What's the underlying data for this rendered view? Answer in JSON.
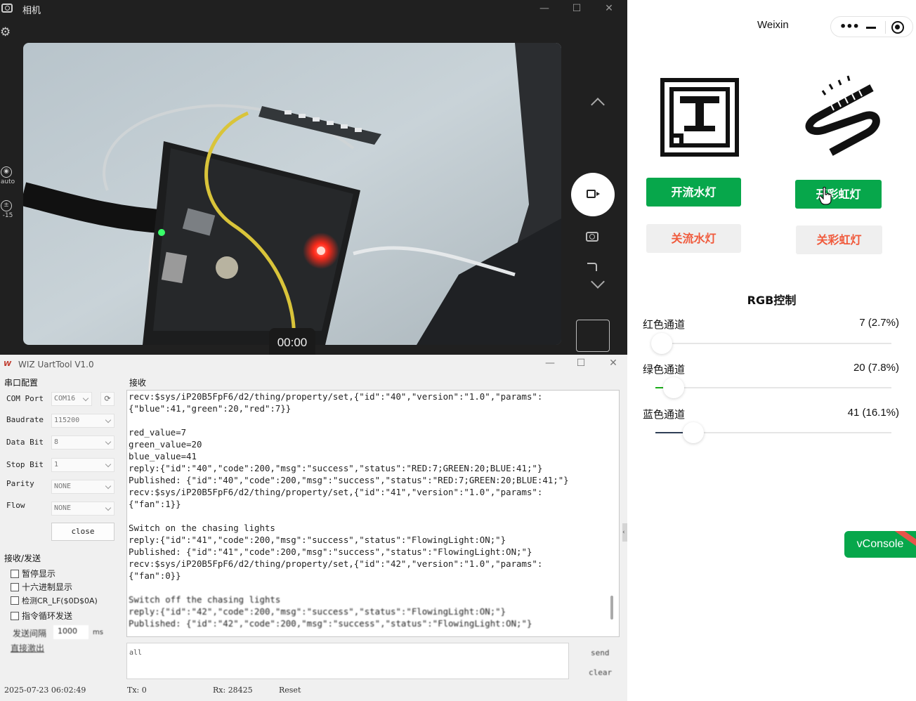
{
  "camera": {
    "title": "相机",
    "timer": "00:00",
    "auto_label": "auto",
    "ev_label": "-15",
    "window_controls": {
      "minimize": "—",
      "maximize": "☐",
      "close": "✕"
    }
  },
  "weixin": {
    "title": "Weixin",
    "buttons": {
      "flow_on": "开流水灯",
      "rainbow_on": "开彩虹灯",
      "flow_off": "关流水灯",
      "rainbow_off": "关彩虹灯"
    },
    "rgb_title": "RGB控制",
    "channels": [
      {
        "label": "红色通道",
        "value_text": "7 (2.7%)",
        "fraction": 0.027,
        "color": "#e64340"
      },
      {
        "label": "绿色通道",
        "value_text": "20 (7.8%)",
        "fraction": 0.078,
        "color": "#1aad19"
      },
      {
        "label": "蓝色通道",
        "value_text": "41 (16.1%)",
        "fraction": 0.161,
        "color": "#2f3f56"
      }
    ],
    "vconsole": "vConsole",
    "accent": "#07a74b",
    "off_text_color": "#f05a3c"
  },
  "uart": {
    "title": "WIZ UartTool V1.0",
    "serial_section": "串口配置",
    "fields": [
      {
        "label": "COM Port",
        "value": "COM16"
      },
      {
        "label": "Baudrate",
        "value": "115200"
      },
      {
        "label": "Data Bit",
        "value": "8"
      },
      {
        "label": "Stop Bit",
        "value": "1"
      },
      {
        "label": "Parity",
        "value": "NONE"
      },
      {
        "label": "Flow",
        "value": "NONE"
      }
    ],
    "close_button": "close",
    "send_recv_section": "接收/发送",
    "checkboxes": [
      "暂停显示",
      "十六进制显示",
      "检测CR_LF($0D$0A)",
      "指令循环发送"
    ],
    "interval_label": "发送间隔",
    "interval_value": "1000",
    "interval_unit": "ms",
    "clear_link": "直接激出",
    "recv_section": "接收",
    "recv_lines": [
      "recv:$sys/iP20B5FpF6/d2/thing/property/set,{\"id\":\"40\",\"version\":\"1.0\",\"params\":",
      "{\"blue\":41,\"green\":20,\"red\":7}}",
      "",
      "red_value=7",
      "green_value=20",
      "blue_value=41",
      "reply:{\"id\":\"40\",\"code\":200,\"msg\":\"success\",\"status\":\"RED:7;GREEN:20;BLUE:41;\"}",
      "Published: {\"id\":\"40\",\"code\":200,\"msg\":\"success\",\"status\":\"RED:7;GREEN:20;BLUE:41;\"}",
      "recv:$sys/iP20B5FpF6/d2/thing/property/set,{\"id\":\"41\",\"version\":\"1.0\",\"params\":",
      "{\"fan\":1}}",
      "",
      "Switch on the chasing lights",
      "reply:{\"id\":\"41\",\"code\":200,\"msg\":\"success\",\"status\":\"FlowingLight:ON;\"}",
      "Published: {\"id\":\"41\",\"code\":200,\"msg\":\"success\",\"status\":\"FlowingLight:ON;\"}",
      "recv:$sys/iP20B5FpF6/d2/thing/property/set,{\"id\":\"42\",\"version\":\"1.0\",\"params\":",
      "{\"fan\":0}}",
      "",
      "Switch off the chasing lights",
      "reply:{\"id\":\"42\",\"code\":200,\"msg\":\"success\",\"status\":\"FlowingLight:ON;\"}",
      "Published: {\"id\":\"42\",\"code\":200,\"msg\":\"success\",\"status\":\"FlowingLight:ON;\"}"
    ],
    "send_text": "all",
    "send_button": "send",
    "clear_button": "clear",
    "status": {
      "datetime": "2025-07-23 06:02:49",
      "tx": "Tx: 0",
      "rx": "Rx: 28425",
      "reset": "Reset"
    }
  }
}
